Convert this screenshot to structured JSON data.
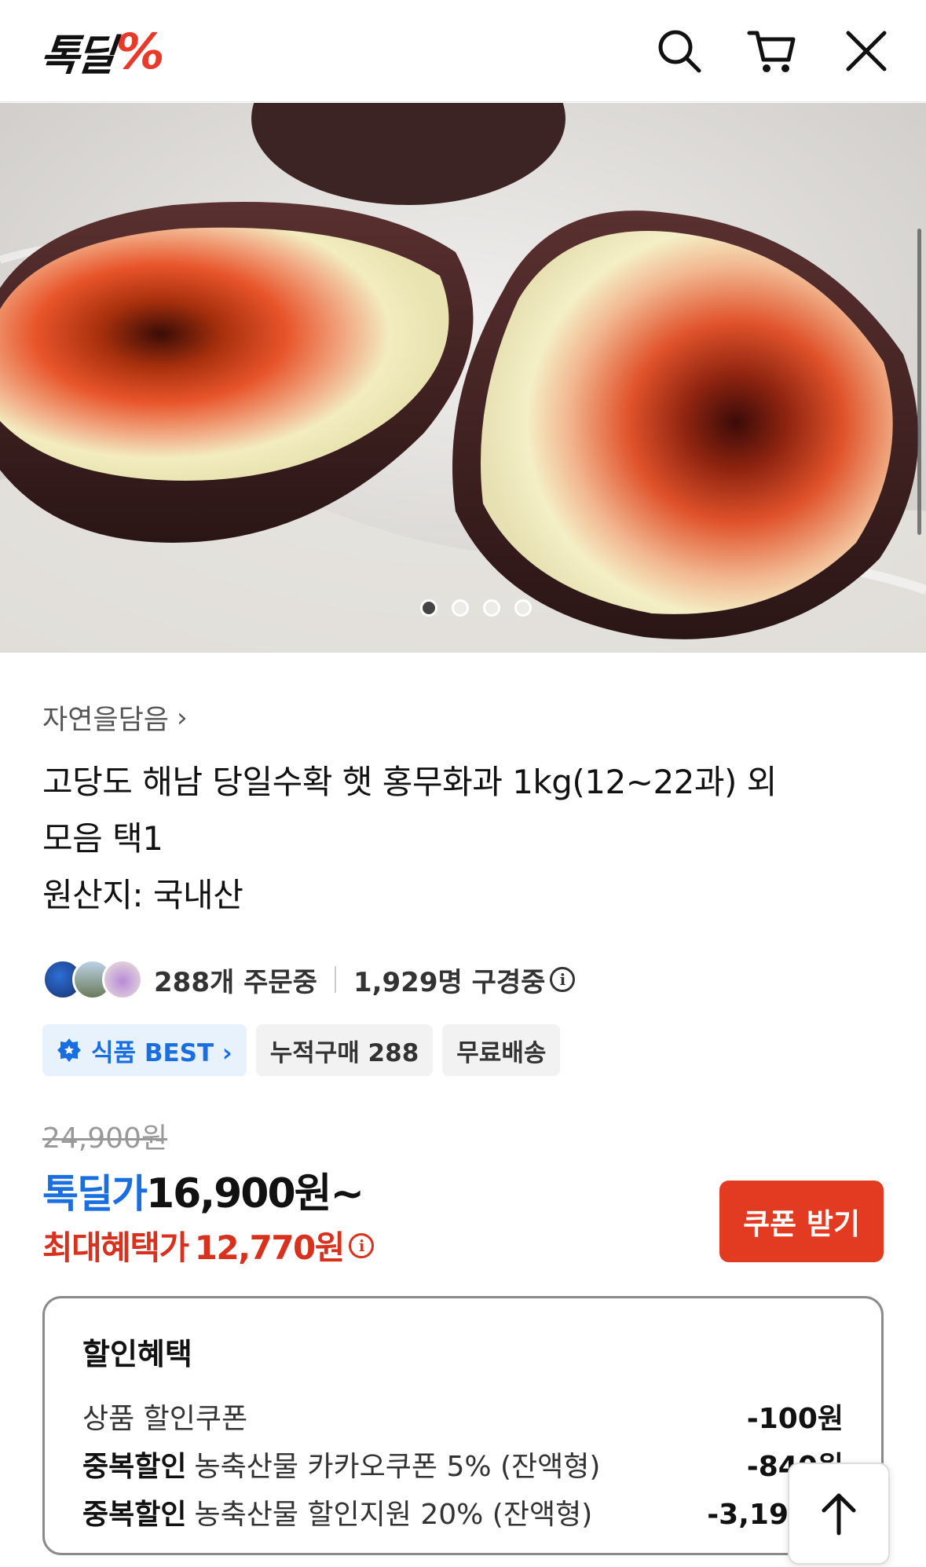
{
  "header": {
    "logo_text": "톡딜",
    "logo_mark": "%",
    "icons": [
      "search-icon",
      "cart-icon",
      "close-icon"
    ]
  },
  "gallery": {
    "current_slide": 1,
    "total_slides": 4
  },
  "product": {
    "seller": "자연을담음",
    "seller_chevron": "›",
    "title_line1": "고당도 해남 당일수확 햇 홍무화과 1kg(12~22과) 외",
    "title_line2": "모음 택1",
    "origin": "원산지: 국내산"
  },
  "stats": {
    "orders": "288개 주문중",
    "viewers": "1,929명 구경중",
    "info_glyph": "i"
  },
  "chips": {
    "best": "식품 BEST ›",
    "cumulative": "누적구매 288",
    "shipping": "무료배송"
  },
  "price": {
    "original": "24,900원",
    "sale_label": "톡딜가",
    "sale_value": "16,900원~",
    "max_label": "최대혜택가",
    "max_value": "12,770원",
    "coupon_button": "쿠폰 받기"
  },
  "discount": {
    "title": "할인혜택",
    "rows": [
      {
        "prefix": "",
        "label": "상품 할인쿠폰",
        "amount": "-100원"
      },
      {
        "prefix": "중복할인",
        "label": "농축산물 카카오쿠폰 5% (잔액형)",
        "amount": "-840원"
      },
      {
        "prefix": "중복할인",
        "label": "농축산물 할인지원 20% (잔액형)",
        "amount": "-3,19"
      }
    ]
  },
  "colors": {
    "accent_blue": "#1a6fe0",
    "accent_red": "#e23b22",
    "logo_red": "#e83a2a"
  }
}
